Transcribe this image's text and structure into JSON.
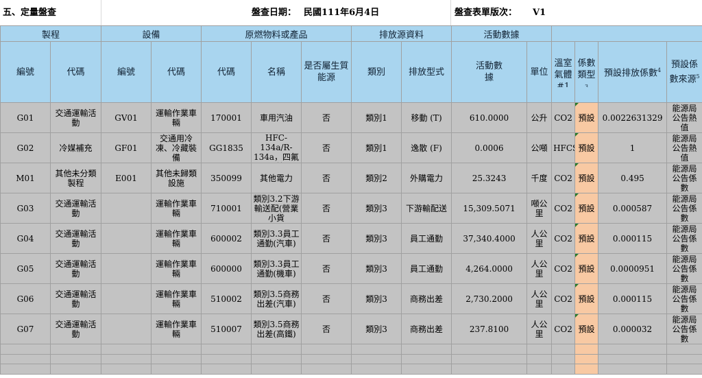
{
  "title_bar": {
    "section": "五、定量盤查",
    "date_label": "盤查日期：",
    "date_value": "民國111年6月4日",
    "version_label": "盤查表單版次：",
    "version_value": "V1"
  },
  "group_headers": {
    "process": "製程",
    "equipment": "設備",
    "material": "原燃物料或產品",
    "source": "排放源資料",
    "activity": "活動數據",
    "blank": ""
  },
  "sub_headers": {
    "process_id": "編號",
    "process_code": "代碼",
    "equip_id": "編號",
    "equip_code": "代碼",
    "mat_code": "代碼",
    "mat_name": "名稱",
    "biomass": "是否屬生質能源",
    "category": "類別",
    "emission_type": "排放型式",
    "activity_data": "活動數據",
    "unit": "單位",
    "ghg": "溫室氣體#1",
    "coef_type": "係數類型",
    "coef_type_sup": "3",
    "default_factor": "預設排放係數",
    "default_factor_sup": "4",
    "coef_source": "預設係數來源",
    "coef_source_sup": "5"
  },
  "rows": [
    {
      "pid": "G01",
      "pcode": "交通運輸活動",
      "eid": "GV01",
      "ecode": "運輸作業車輛",
      "mcode": "170001",
      "mname": "車用汽油",
      "bio": "否",
      "cat": "類別1",
      "etype": "移動 (T)",
      "act": "610.0000",
      "unit": "公升",
      "gas": "CO2",
      "ctype": "預設",
      "factor": "0.0022631329",
      "src": "能源局公告熱值"
    },
    {
      "pid": "G02",
      "pcode": "冷媒補充",
      "eid": "GF01",
      "ecode": "交通用冷凍、冷藏裝備",
      "mcode": "GG1835",
      "mname": "HFC-134a/R-134a，四氟乙烷",
      "bio": "否",
      "cat": "類別1",
      "etype": "逸散 (F)",
      "act": "0.0006",
      "unit": "公噸",
      "gas": "HFCS",
      "ctype": "預設",
      "factor": "1",
      "src": "能源局公告熱值"
    },
    {
      "pid": "M01",
      "pcode": "其他未分類製程",
      "eid": "E001",
      "ecode": "其他未歸類設施",
      "mcode": "350099",
      "mname": "其他電力",
      "bio": "否",
      "cat": "類別2",
      "etype": "外購電力",
      "act": "25.3243",
      "unit": "千度",
      "gas": "CO2",
      "ctype": "預設",
      "factor": "0.495",
      "src": "能源局公告係數"
    },
    {
      "pid": "G03",
      "pcode": "交通運輸活動",
      "eid": "",
      "ecode": "運輸作業車輛",
      "mcode": "710001",
      "mname": "類別3.2下游輸送配(營業小貨",
      "bio": "否",
      "cat": "類別3",
      "etype": "下游輸配送",
      "act": "15,309.5071",
      "unit": "噸公里",
      "gas": "CO2",
      "ctype": "預設",
      "factor": "0.000587",
      "src": "能源局公告係數"
    },
    {
      "pid": "G04",
      "pcode": "交通運輸活動",
      "eid": "",
      "ecode": "運輸作業車輛",
      "mcode": "600002",
      "mname": "類別3.3員工通勤(汽車)",
      "bio": "否",
      "cat": "類別3",
      "etype": "員工通勤",
      "act": "37,340.4000",
      "unit": "人公里",
      "gas": "CO2",
      "ctype": "預設",
      "factor": "0.000115",
      "src": "能源局公告係數"
    },
    {
      "pid": "G05",
      "pcode": "交通運輸活動",
      "eid": "",
      "ecode": "運輸作業車輛",
      "mcode": "600000",
      "mname": "類別3.3員工通勤(機車)",
      "bio": "否",
      "cat": "類別3",
      "etype": "員工通勤",
      "act": "4,264.0000",
      "unit": "人公里",
      "gas": "CO2",
      "ctype": "預設",
      "factor": "0.0000951",
      "src": "能源局公告係數"
    },
    {
      "pid": "G06",
      "pcode": "交通運輸活動",
      "eid": "",
      "ecode": "運輸作業車輛",
      "mcode": "510002",
      "mname": "類別3.5商務出差(汽車)",
      "bio": "否",
      "cat": "類別3",
      "etype": "商務出差",
      "act": "2,730.2000",
      "unit": "人公里",
      "gas": "CO2",
      "ctype": "預設",
      "factor": "0.000115",
      "src": "能源局公告係數"
    },
    {
      "pid": "G07",
      "pcode": "交通運輸活動",
      "eid": "",
      "ecode": "運輸作業車輛",
      "mcode": "510007",
      "mname": "類別3.5商務出差(高鐵)",
      "bio": "否",
      "cat": "類別3",
      "etype": "商務出差",
      "act": "237.8100",
      "unit": "人公里",
      "gas": "CO2",
      "ctype": "預設",
      "factor": "0.000032",
      "src": "能源局公告係數"
    }
  ]
}
